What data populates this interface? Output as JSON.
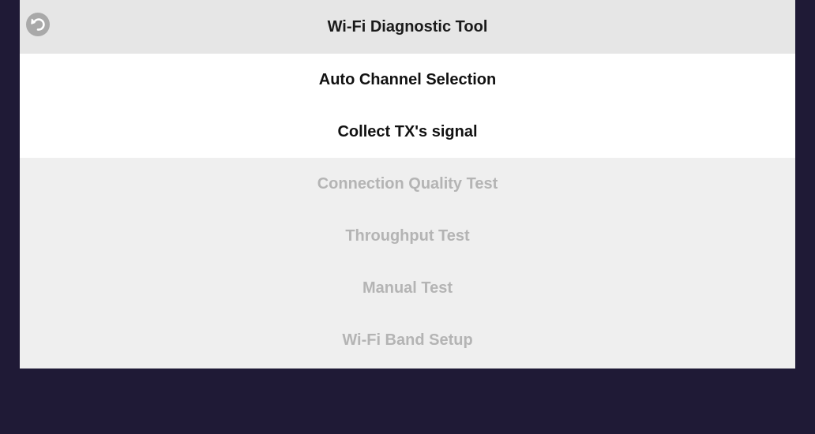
{
  "header": {
    "title": "Wi-Fi Diagnostic Tool",
    "back_icon": "back-arrow-icon"
  },
  "menu": {
    "items": [
      {
        "label": "Auto Channel Selection",
        "enabled": true
      },
      {
        "label": "Collect TX's signal",
        "enabled": true
      },
      {
        "label": "Connection Quality Test",
        "enabled": false
      },
      {
        "label": "Throughput Test",
        "enabled": false
      },
      {
        "label": "Manual Test",
        "enabled": false
      },
      {
        "label": "Wi-Fi Band Setup",
        "enabled": false
      }
    ]
  },
  "colors": {
    "background": "#1f1a36",
    "enabled_bg": "#ffffff",
    "disabled_bg": "#efefef",
    "disabled_text": "#b4b4b4"
  }
}
